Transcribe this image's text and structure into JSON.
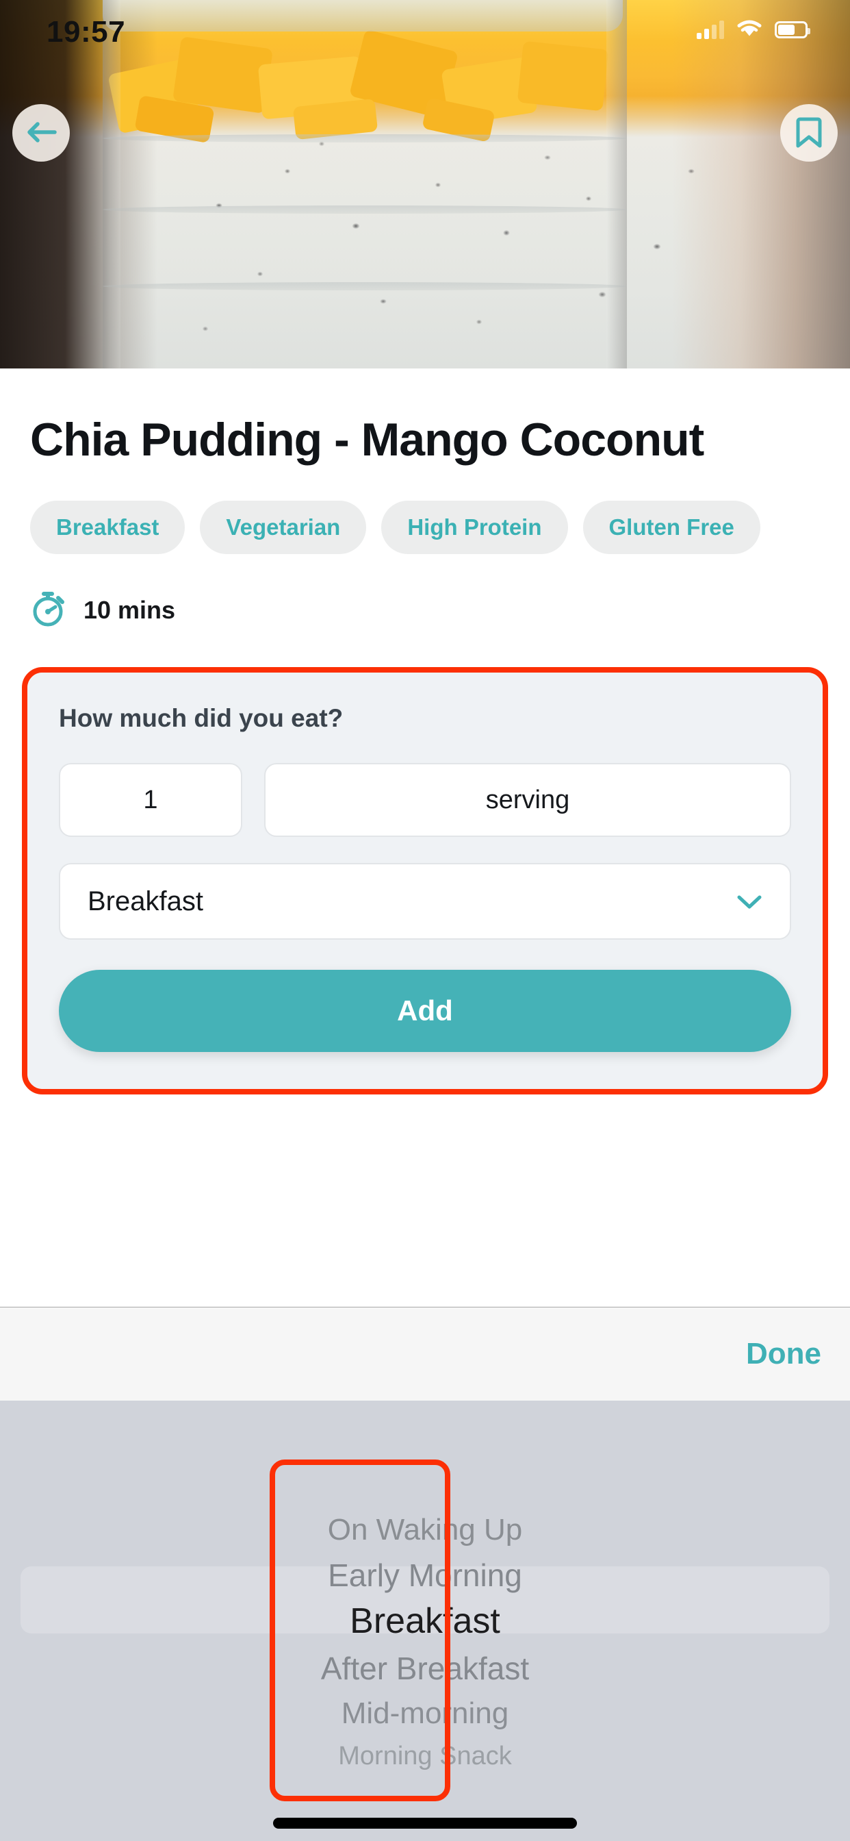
{
  "status_bar": {
    "time": "19:57",
    "signal_icon": "signal-bars-icon",
    "wifi_icon": "wifi-icon",
    "battery_icon": "battery-icon"
  },
  "hero": {
    "back_icon": "back-arrow-icon",
    "bookmark_icon": "bookmark-icon",
    "image_alt": "chia-pudding-mango-coconut-photo"
  },
  "recipe": {
    "title": "Chia Pudding - Mango Coconut",
    "tags": [
      "Breakfast",
      "Vegetarian",
      "High Protein",
      "Gluten Free"
    ],
    "time_icon": "stopwatch-icon",
    "time_label": "10 mins"
  },
  "log_card": {
    "question": "How much did you eat?",
    "quantity_value": "1",
    "quantity_placeholder": "1",
    "unit_value": "serving",
    "unit_placeholder": "serving",
    "meal_value": "Breakfast",
    "meal_chevron_icon": "chevron-down-icon",
    "add_label": "Add"
  },
  "picker": {
    "done_label": "Done",
    "selected": "Breakfast",
    "options": [
      "On Waking Up",
      "Early Morning",
      "Breakfast",
      "After Breakfast",
      "Mid-morning",
      "Morning Snack"
    ]
  },
  "colors": {
    "accent_teal": "#45b2b7",
    "tag_text": "#3bb1b4",
    "highlight_red": "#fc2f05",
    "card_bg": "#eff2f5",
    "picker_bg": "#d0d3da"
  }
}
